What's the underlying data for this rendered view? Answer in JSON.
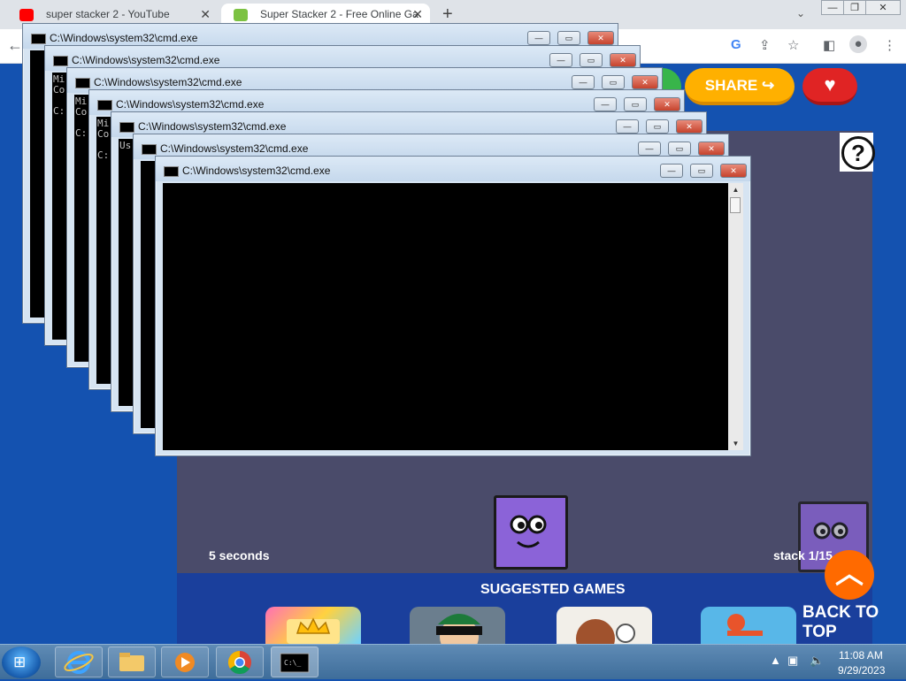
{
  "browser": {
    "tabs": [
      {
        "title": "super stacker 2 - YouTube",
        "favicon_color": "#ff0000",
        "active": false
      },
      {
        "title": "Super Stacker 2 - Free Online Ga",
        "favicon_color": "#7cc242",
        "active": true
      }
    ],
    "new_tab_symbol": "+",
    "tab_close_symbol": "✕",
    "tab_menu_icon": "chevron-down-icon",
    "window_controls": {
      "minimize": "—",
      "restore": "❐",
      "close": "✕"
    },
    "toolbar_icons": [
      "google-lens-icon",
      "share-icon",
      "bookmark-star-icon",
      "side-panel-icon",
      "profile-icon",
      "more-menu-icon"
    ]
  },
  "page": {
    "share_label": "SHARE",
    "help_symbol": "?",
    "timer_text": "5 seconds",
    "stack_text": "stack 1/15",
    "suggested_title": "SUGGESTED GAMES",
    "back_to_top_label": "BACK TO TOP",
    "colors": {
      "background": "#1452b0",
      "share": "#ffb000",
      "heart": "#e02424",
      "game_area": "#4a4b6a",
      "block": "#8b63d8",
      "back_to_top": "#ff6a00"
    }
  },
  "cmd_windows": [
    {
      "title": "C:\\Windows\\system32\\cmd.exe",
      "text": ""
    },
    {
      "title": "C:\\Windows\\system32\\cmd.exe",
      "text": "Mi\nCo\n\nC:"
    },
    {
      "title": "C:\\Windows\\system32\\cmd.exe",
      "text": "Mi\nCo\n\nC:"
    },
    {
      "title": "C:\\Windows\\system32\\cmd.exe",
      "text": "Mi\nCo\n\nC:"
    },
    {
      "title": "C:\\Windows\\system32\\cmd.exe",
      "text": "Us"
    },
    {
      "title": "C:\\Windows\\system32\\cmd.exe",
      "text": ""
    },
    {
      "title": "C:\\Windows\\system32\\cmd.exe",
      "text": ""
    }
  ],
  "cmd_buttons": {
    "minimize": "—",
    "maximize": "▭",
    "close": "✕"
  },
  "taskbar": {
    "apps": [
      "internet-explorer-icon",
      "file-explorer-icon",
      "media-player-icon",
      "chrome-icon",
      "cmd-icon"
    ],
    "time": "11:08 AM",
    "date": "9/29/2023",
    "tray_icons": [
      "show-hidden-icons-icon",
      "network-icon",
      "volume-muted-icon"
    ]
  }
}
